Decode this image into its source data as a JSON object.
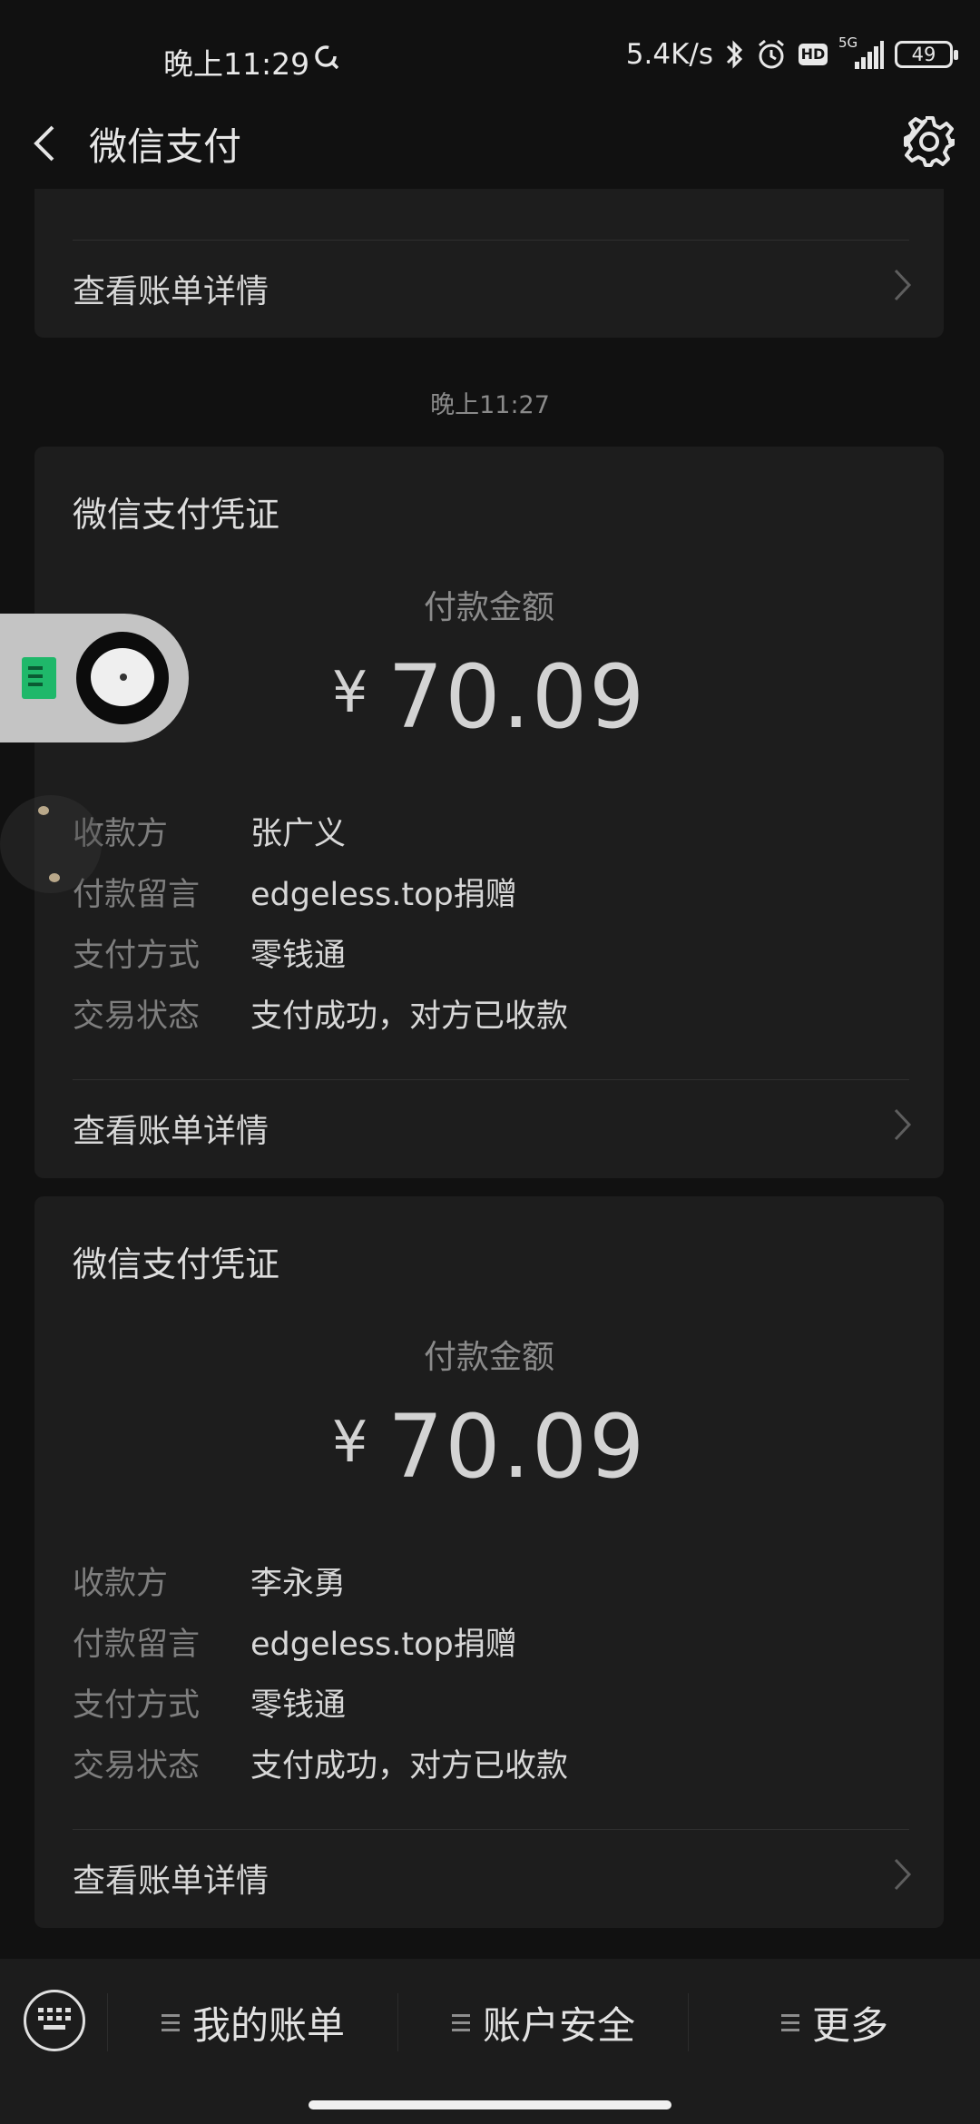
{
  "status_bar": {
    "time": "晚上11:29",
    "net_speed": "5.4K/s",
    "signal_label": "5G",
    "hd_label": "HD",
    "battery": "49",
    "icons": [
      "sync-icon",
      "bluetooth-icon",
      "alarm-icon",
      "hd-icon",
      "signal-icon",
      "battery-icon"
    ]
  },
  "header": {
    "title": "微信支付",
    "back_icon": "back-arrow-icon",
    "settings_icon": "gear-icon"
  },
  "top_card": {
    "detail_link": "查看账单详情"
  },
  "timestamp": "晚上11:27",
  "receipts": [
    {
      "title": "微信支付凭证",
      "amount_label": "付款金额",
      "currency": "¥",
      "amount": "70.09",
      "fields": [
        {
          "key": "收款方",
          "value": "张广义"
        },
        {
          "key": "付款留言",
          "value": "edgeless.top捐赠"
        },
        {
          "key": "支付方式",
          "value": "零钱通"
        },
        {
          "key": "交易状态",
          "value": "支付成功，对方已收款"
        }
      ],
      "detail_link": "查看账单详情"
    },
    {
      "title": "微信支付凭证",
      "amount_label": "付款金额",
      "currency": "¥",
      "amount": "70.09",
      "fields": [
        {
          "key": "收款方",
          "value": "李永勇"
        },
        {
          "key": "付款留言",
          "value": "edgeless.top捐赠"
        },
        {
          "key": "支付方式",
          "value": "零钱通"
        },
        {
          "key": "交易状态",
          "value": "支付成功，对方已收款"
        }
      ],
      "detail_link": "查看账单详情"
    }
  ],
  "bottom_bar": {
    "keyboard_icon": "keyboard-icon",
    "menu": [
      {
        "label": "我的账单"
      },
      {
        "label": "账户安全"
      },
      {
        "label": "更多"
      }
    ]
  },
  "colors": {
    "background": "#111111",
    "card": "#1d1d1d",
    "bottom_bar": "#1c1c1c",
    "accent_green": "#1fb86a"
  }
}
